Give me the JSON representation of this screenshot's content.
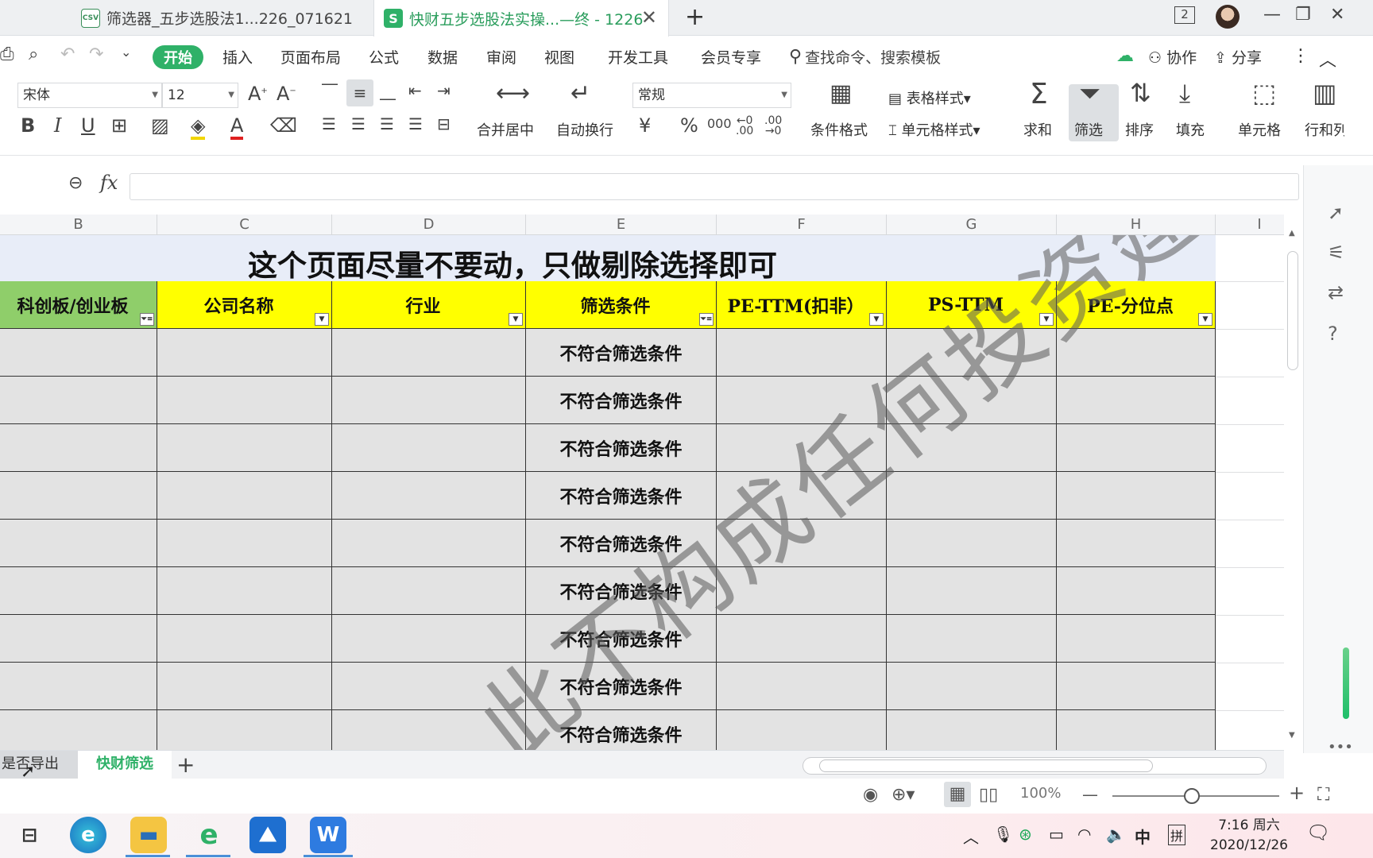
{
  "tabs": [
    {
      "icon": "csv-file-icon",
      "icon_text": "CSV",
      "label": "筛选器_五步选股法1...226_071621"
    },
    {
      "icon": "spreadsheet-file-icon",
      "icon_text": "S",
      "label": "快财五步选股法实操...—终 - 1226"
    }
  ],
  "window": {
    "badge": "2"
  },
  "menu": {
    "start": "开始",
    "items": [
      "插入",
      "页面布局",
      "公式",
      "数据",
      "审阅",
      "视图",
      "开发工具",
      "会员专享"
    ],
    "search_placeholder": "查找命令、搜索模板",
    "collab": "协作",
    "share": "分享"
  },
  "ribbon": {
    "font_name": "宋体",
    "font_size": "12",
    "number_format": "常规",
    "merge_center": "合并居中",
    "wrap_text": "自动换行",
    "cond_format": "条件格式",
    "table_style": "表格样式",
    "cell_style": "单元格样式",
    "sum": "求和",
    "filter": "筛选",
    "sort": "排序",
    "fill": "填充",
    "cell": "单元格",
    "row_col": "行和列"
  },
  "formula": {
    "fx": "fx",
    "value": ""
  },
  "columns": [
    "B",
    "C",
    "D",
    "E",
    "F",
    "G",
    "H",
    "I"
  ],
  "sheet": {
    "banner": "这个页面尽量不要动，只做剔除选择即可",
    "headers": [
      "科创板/创业板",
      "公司名称",
      "行业",
      "筛选条件",
      "PE-TTM(扣非）",
      "PS-TTM",
      "PE-分位点"
    ],
    "filtered_columns": [
      0,
      3
    ],
    "rows": [
      [
        "",
        "",
        "",
        "不符合筛选条件",
        "",
        "",
        ""
      ],
      [
        "",
        "",
        "",
        "不符合筛选条件",
        "",
        "",
        ""
      ],
      [
        "",
        "",
        "",
        "不符合筛选条件",
        "",
        "",
        ""
      ],
      [
        "",
        "",
        "",
        "不符合筛选条件",
        "",
        "",
        ""
      ],
      [
        "",
        "",
        "",
        "不符合筛选条件",
        "",
        "",
        ""
      ],
      [
        "",
        "",
        "",
        "不符合筛选条件",
        "",
        "",
        ""
      ],
      [
        "",
        "",
        "",
        "不符合筛选条件",
        "",
        "",
        ""
      ],
      [
        "",
        "",
        "",
        "不符合筛选条件",
        "",
        "",
        ""
      ],
      [
        "",
        "",
        "",
        "不符合筛选条件",
        "",
        "",
        ""
      ]
    ],
    "watermark": "此不构成任何投资建议"
  },
  "sheet_tabs": [
    "是否导出",
    "快财筛选"
  ],
  "status": {
    "zoom": "100%"
  },
  "taskbar": {
    "apps": [
      "task-view-icon",
      "edge-icon",
      "file-explorer-icon",
      "ie-icon",
      "photos-icon",
      "wps-icon"
    ],
    "ime_lang": "中",
    "ime_mode": "拼",
    "time": "7:16 周六",
    "date": "2020/12/26"
  },
  "colors": {
    "accent": "#2fb168",
    "header_yellow": "#ffff00",
    "header_green": "#8fce6a",
    "cell_gray": "#e3e3e3",
    "banner": "#e8edf8"
  }
}
